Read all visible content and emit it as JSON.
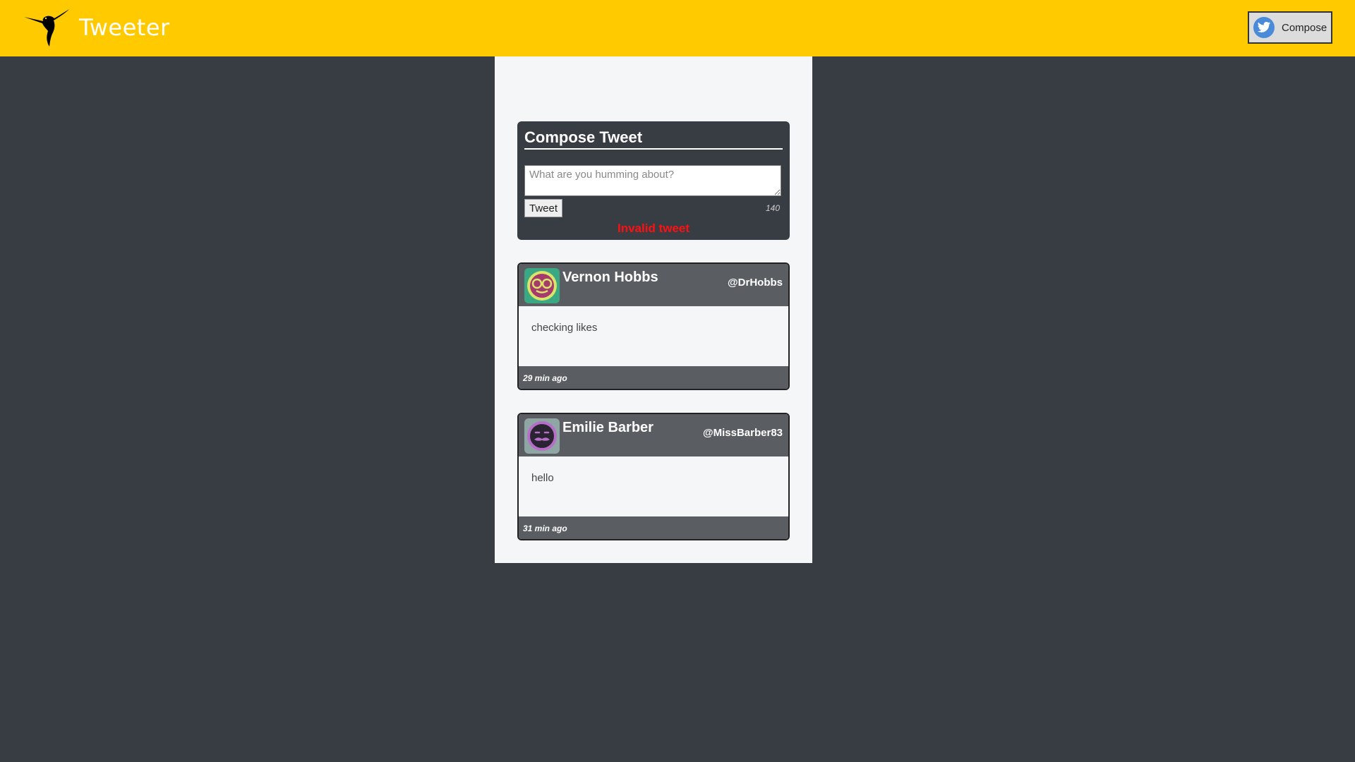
{
  "app": {
    "brand": "Tweeter"
  },
  "header": {
    "compose_label": "Compose"
  },
  "composer": {
    "title": "Compose Tweet",
    "placeholder": "What are you humming about?",
    "tweet_label": "Tweet",
    "counter": "140",
    "error": "Invalid tweet"
  },
  "tweets": [
    {
      "name": "Vernon Hobbs",
      "handle": "@DrHobbs",
      "text": "checking likes",
      "time": "29 min ago",
      "avatar_icon": "glasses-face-avatar",
      "avatar_color": "#3aa882"
    },
    {
      "name": "Emilie Barber",
      "handle": "@MissBarber83",
      "text": "hello",
      "time": "31 min ago",
      "avatar_icon": "mustache-face-avatar",
      "avatar_color": "#8fa6a5"
    }
  ],
  "colors": {
    "navbar": "#ffcb00",
    "page_background": "#383c43",
    "error": "#ff1010",
    "card_header": "#5a5e63"
  },
  "icons": {
    "logo": "hummingbird-icon",
    "compose": "twitter-bird-icon"
  }
}
